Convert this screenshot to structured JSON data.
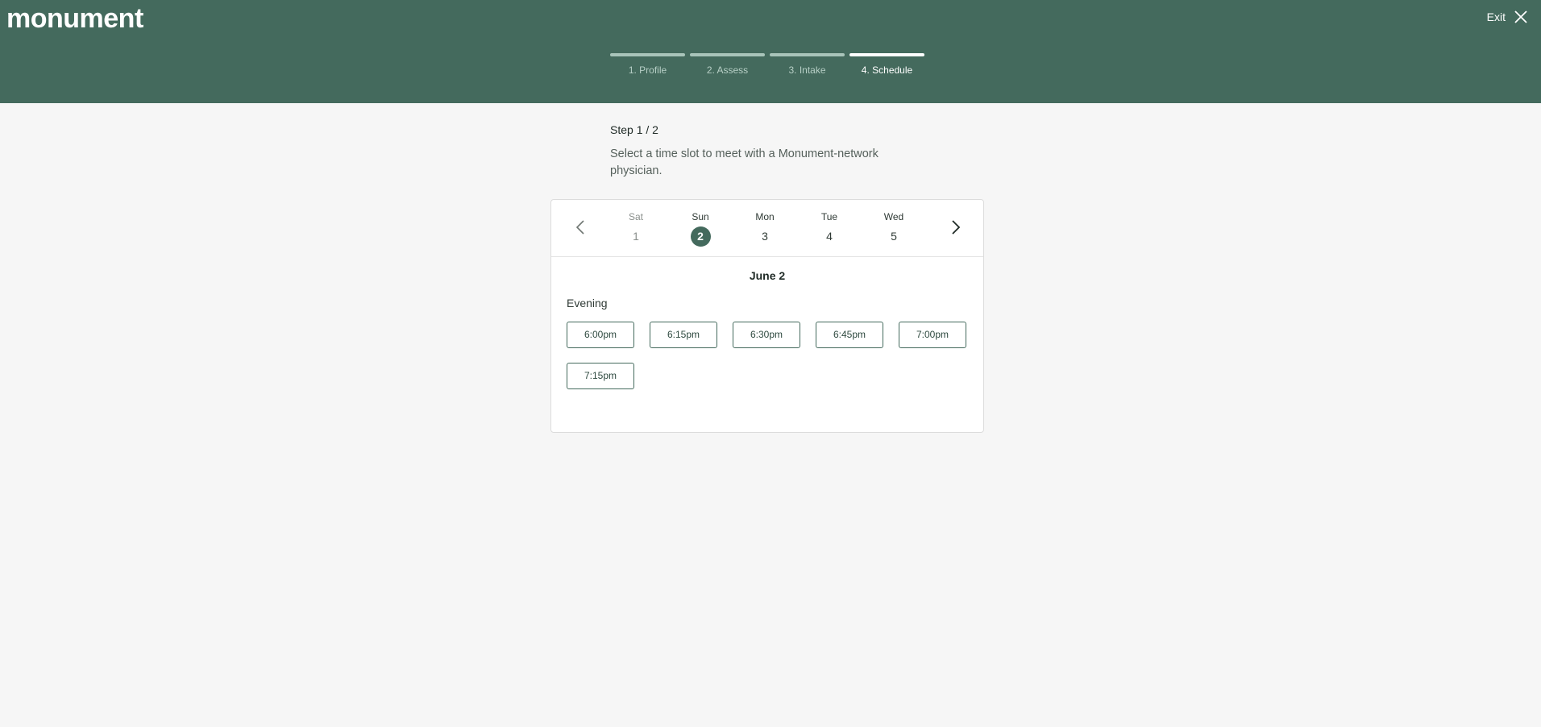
{
  "header": {
    "logo": "monument",
    "exit_label": "Exit",
    "background": "#446a5d",
    "steps": [
      {
        "label": "1. Profile",
        "active": false
      },
      {
        "label": "2. Assess",
        "active": false
      },
      {
        "label": "3. Intake",
        "active": false
      },
      {
        "label": "4. Schedule",
        "active": true
      }
    ]
  },
  "intro": {
    "step_count": "Step 1 / 2",
    "instructions": "Select a time slot to meet with a Monument-network physician."
  },
  "calendar": {
    "days": [
      {
        "dow": "Sat",
        "num": "1",
        "state": "muted"
      },
      {
        "dow": "Sun",
        "num": "2",
        "state": "selected"
      },
      {
        "dow": "Mon",
        "num": "3",
        "state": "normal"
      },
      {
        "dow": "Tue",
        "num": "4",
        "state": "normal"
      },
      {
        "dow": "Wed",
        "num": "5",
        "state": "normal"
      }
    ],
    "date_title": "June 2",
    "period": "Evening",
    "slots": [
      "6:00pm",
      "6:15pm",
      "6:30pm",
      "6:45pm",
      "7:00pm",
      "7:15pm"
    ],
    "icons": {
      "prev": "chevron-left-icon",
      "next": "chevron-right-icon"
    }
  }
}
